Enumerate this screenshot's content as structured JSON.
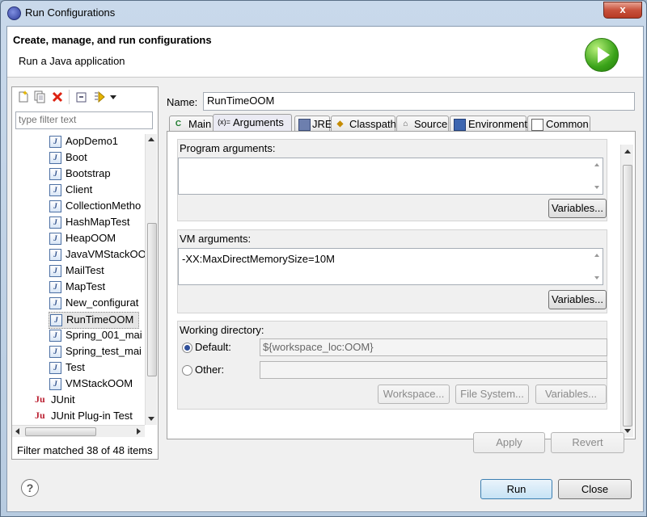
{
  "window": {
    "title": "Run Configurations",
    "close_glyph": "x"
  },
  "header": {
    "title": "Create, manage, and run configurations",
    "subtitle": "Run a Java application"
  },
  "left": {
    "filter_placeholder": "type filter text",
    "items": [
      "AopDemo1",
      "Boot",
      "Bootstrap",
      "Client",
      "CollectionMetho",
      "HashMapTest",
      "HeapOOM",
      "JavaVMStackOO",
      "MailTest",
      "MapTest",
      "New_configurat",
      "RunTimeOOM",
      "Spring_001_mai",
      "Spring_test_mai",
      "Test",
      "VMStackOOM"
    ],
    "selected": "RunTimeOOM",
    "categories": [
      "JUnit",
      "JUnit Plug-in Test"
    ],
    "status": "Filter matched 38 of 48 items"
  },
  "name": {
    "label": "Name:",
    "value": "RunTimeOOM"
  },
  "tabs": [
    "Main",
    "Arguments",
    "JRE",
    "Classpath",
    "Source",
    "Environment",
    "Common"
  ],
  "active_tab": "Arguments",
  "arguments": {
    "program_label": "Program arguments:",
    "program_value": "",
    "vm_label": "VM arguments:",
    "vm_value": "-XX:MaxDirectMemorySize=10M",
    "variables_label": "Variables..."
  },
  "workdir": {
    "label": "Working directory:",
    "default_label": "Default:",
    "default_value": "${workspace_loc:OOM}",
    "other_label": "Other:",
    "workspace_btn": "Workspace...",
    "filesystem_btn": "File System...",
    "variables_btn": "Variables..."
  },
  "buttons": {
    "apply": "Apply",
    "revert": "Revert",
    "run": "Run",
    "close": "Close",
    "help": "?"
  },
  "colors": {
    "titlebar": "#c9d9eb",
    "close_red": "#c8513c",
    "run_green": "#3aa319"
  }
}
